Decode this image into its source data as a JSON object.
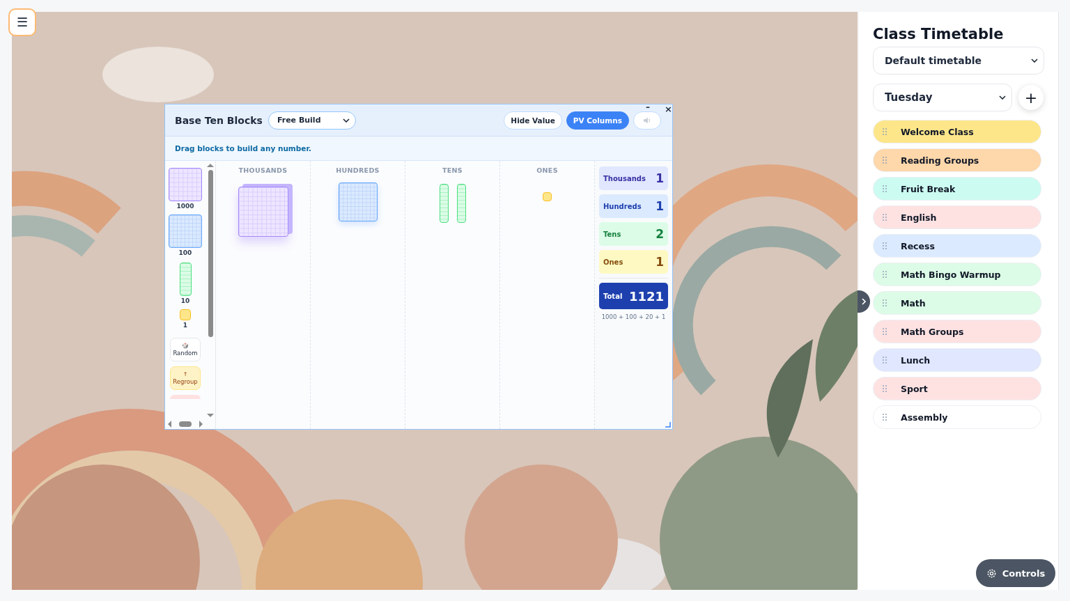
{
  "menu_button": {
    "label": "☰"
  },
  "widget": {
    "title": "Base Ten Blocks",
    "mode": "Free Build",
    "buttons": [
      {
        "label": "Hide Value",
        "selected": false
      },
      {
        "label": "PV Columns",
        "selected": true
      }
    ],
    "minimize": "–",
    "close": "×",
    "instruction": "Drag blocks to build any number.",
    "palette": [
      {
        "kind": "thousand",
        "label": "1000"
      },
      {
        "kind": "hundred",
        "label": "100"
      },
      {
        "kind": "ten",
        "label": "10"
      },
      {
        "kind": "one",
        "label": "1"
      }
    ],
    "actions": [
      {
        "kind": "random",
        "label": "Random",
        "icon": "🎲"
      },
      {
        "kind": "regroup",
        "label": "Regroup",
        "icon": "↑"
      }
    ],
    "columns": [
      {
        "heading": "THOUSANDS",
        "kind": "thousand"
      },
      {
        "heading": "HUNDREDS",
        "kind": "hundred"
      },
      {
        "heading": "TENS",
        "kind": "ten"
      },
      {
        "heading": "ONES",
        "kind": "one"
      }
    ],
    "counters": [
      {
        "label": "Thousands",
        "value": "1",
        "kind": "thousand"
      },
      {
        "label": "Hundreds",
        "value": "1",
        "kind": "hundred"
      },
      {
        "label": "Tens",
        "value": "2",
        "kind": "ten"
      },
      {
        "label": "Ones",
        "value": "1",
        "kind": "one"
      }
    ],
    "total": {
      "label": "Total",
      "value": "1121"
    },
    "expansion": "1000 + 100 + 20 + 1"
  },
  "sidebar": {
    "title": "Class Timetable",
    "timetable": "Default timetable",
    "day": "Tuesday",
    "add": "+",
    "items": [
      {
        "label": "Welcome Class",
        "color": "#fde68a"
      },
      {
        "label": "Reading Groups",
        "color": "#fed7aa"
      },
      {
        "label": "Fruit Break",
        "color": "#ccfbf1"
      },
      {
        "label": "English",
        "color": "#fee2e2"
      },
      {
        "label": "Recess",
        "color": "#dbeafe"
      },
      {
        "label": "Math Bingo Warmup",
        "color": "#dcfce7"
      },
      {
        "label": "Math",
        "color": "#dcfce7"
      },
      {
        "label": "Math Groups",
        "color": "#fee2e2"
      },
      {
        "label": "Lunch",
        "color": "#e0e7ff"
      },
      {
        "label": "Sport",
        "color": "#fee2e2"
      },
      {
        "label": "Assembly",
        "color": "#ffffff"
      }
    ]
  },
  "controls_button": {
    "label": "Controls"
  }
}
